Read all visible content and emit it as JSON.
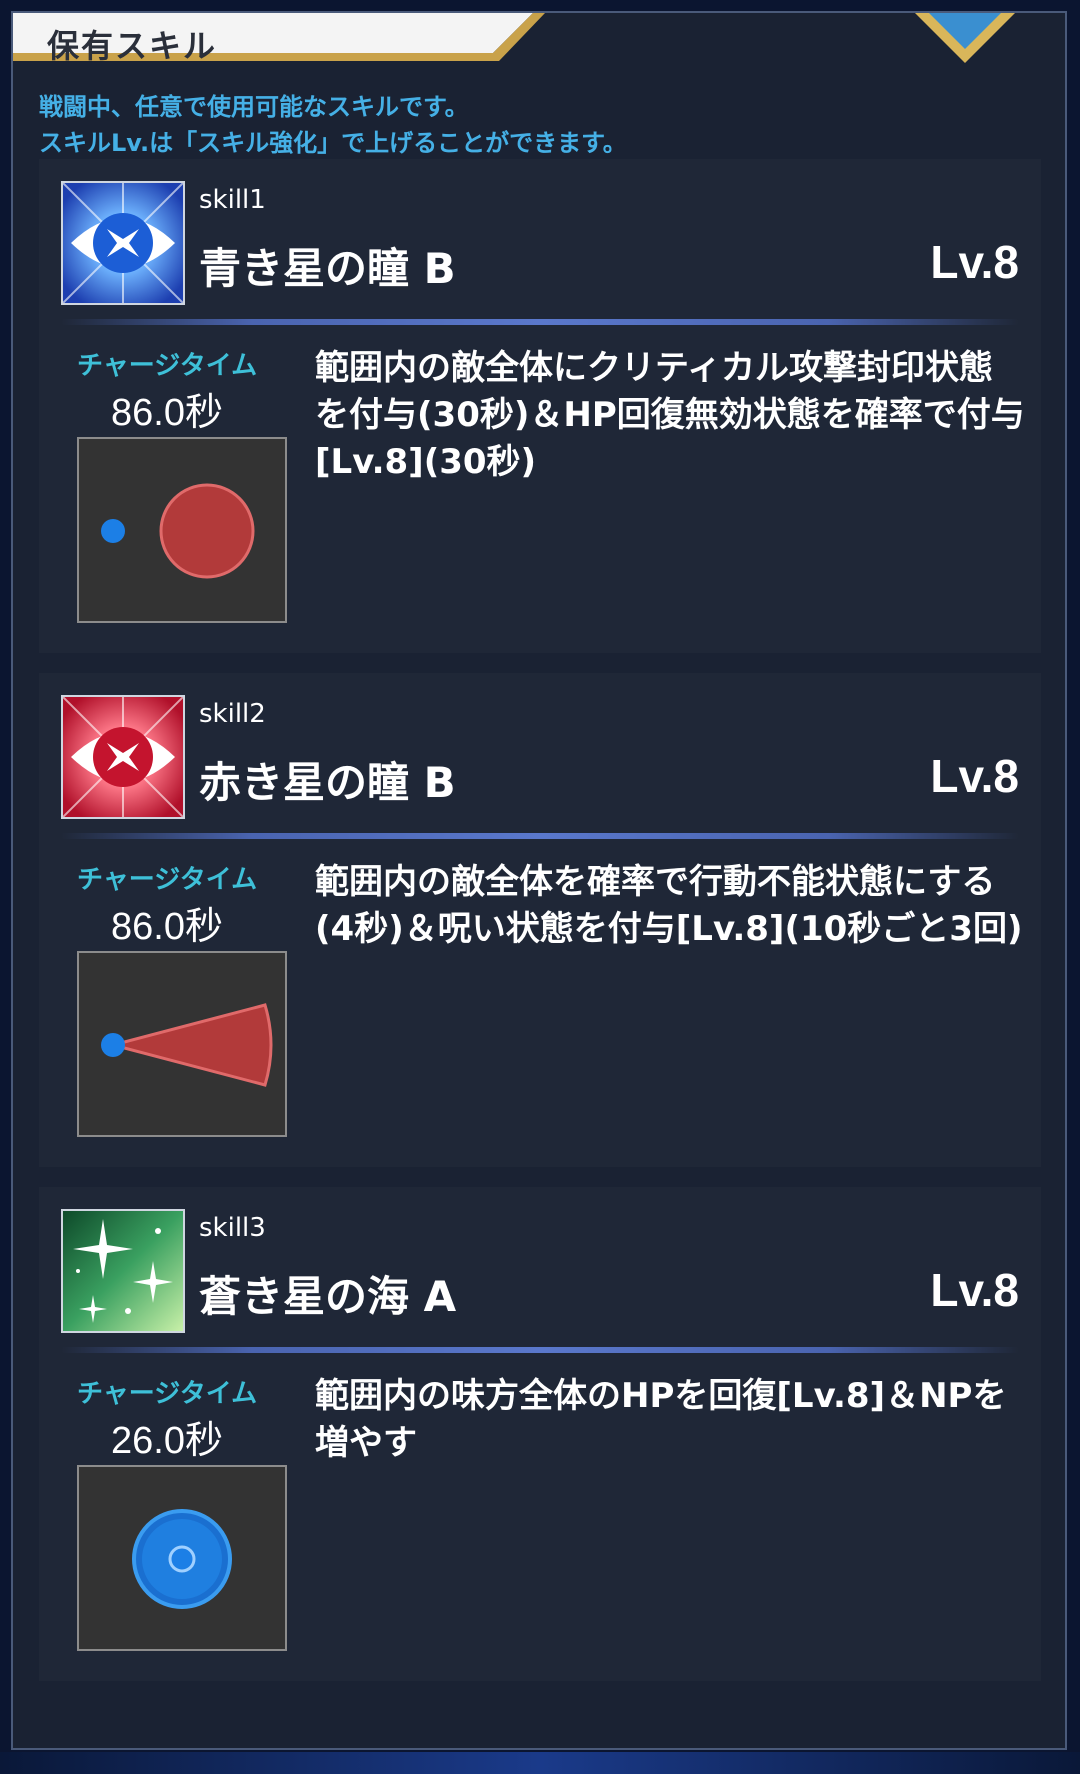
{
  "header": {
    "title": "保有スキル"
  },
  "intro": {
    "line1": "戦闘中、任意で使用可能なスキルです。",
    "line2": "スキルLv.は「スキル強化」で上げることができます。"
  },
  "colors": {
    "accent_text": "#45b0e6",
    "charge_label": "#3ec0d8",
    "card_bg": "#1f2737",
    "panel_bg": "#1a2233"
  },
  "skills": [
    {
      "slot": "skill1",
      "name": "青き星の瞳 B",
      "level": "Lv.8",
      "icon": "blue-eye-icon",
      "charge_label": "チャージタイム",
      "charge_time": "86.0秒",
      "range_type": "circle-area",
      "description": [
        "範囲内の敵全体にクリティカル攻撃封印状態",
        "を付与(30秒)＆HP回復無効状態を確率で付与",
        "[Lv.8](30秒)"
      ]
    },
    {
      "slot": "skill2",
      "name": "赤き星の瞳 B",
      "level": "Lv.8",
      "icon": "red-eye-icon",
      "charge_label": "チャージタイム",
      "charge_time": "86.0秒",
      "range_type": "cone-area",
      "description": [
        "範囲内の敵全体を確率で行動不能状態にする",
        "(4秒)＆呪い状態を付与[Lv.8](10秒ごと3回)"
      ]
    },
    {
      "slot": "skill3",
      "name": "蒼き星の海 A",
      "level": "Lv.8",
      "icon": "green-sparkle-icon",
      "charge_label": "チャージタイム",
      "charge_time": "26.0秒",
      "range_type": "self-circle-area",
      "description": [
        "範囲内の味方全体のHPを回復[Lv.8]＆NPを",
        "増やす"
      ]
    }
  ]
}
